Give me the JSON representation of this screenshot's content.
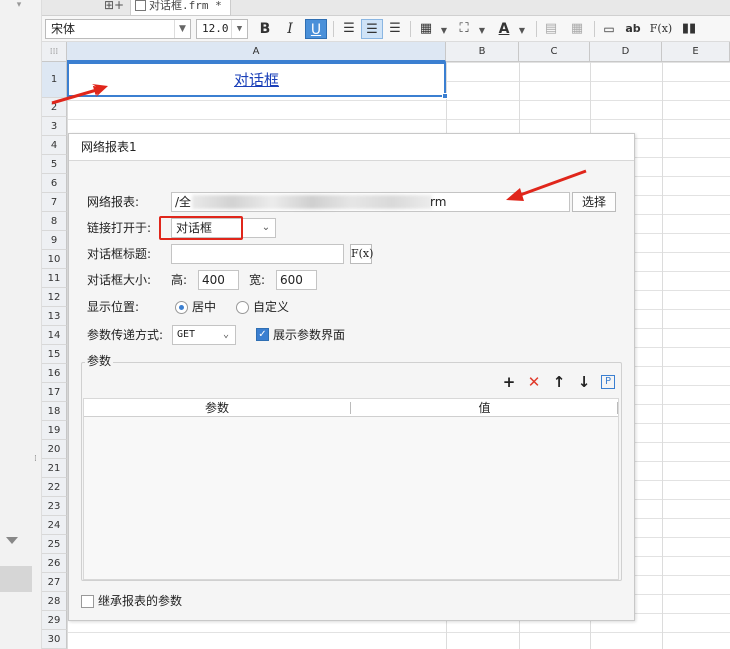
{
  "tab": {
    "label": "对话框.frm *"
  },
  "toolbar": {
    "font_name": "宋体",
    "font_size": "12.0",
    "bold": "B",
    "italic": "I",
    "underline": "U",
    "text_color_glyph": "A",
    "ab_glyph": "ab",
    "fx_glyph": "F(x)"
  },
  "grid": {
    "columns": [
      "A",
      "B",
      "C",
      "D",
      "E"
    ],
    "rows": [
      "1",
      "2",
      "3",
      "4",
      "5",
      "6",
      "7",
      "8",
      "9",
      "10",
      "11",
      "12",
      "13",
      "14",
      "15",
      "16",
      "17",
      "18",
      "19",
      "20",
      "21",
      "22",
      "23",
      "24",
      "25",
      "26",
      "27",
      "28",
      "29",
      "30"
    ],
    "active_cell": "A1",
    "cell_a1_text": "对话框"
  },
  "dialog": {
    "title": "网络报表1",
    "report_label": "网络报表:",
    "report_value_prefix": "/全",
    "report_value_suffix": "rm",
    "choose_button": "选择",
    "open_in_label": "链接打开于:",
    "open_in_value": "对话框",
    "title_label": "对话框标题:",
    "title_value": "",
    "fx_button": "F(x)",
    "size_label": "对话框大小:",
    "height_label": "高:",
    "height_value": "400",
    "width_label": "宽:",
    "width_value": "600",
    "position_label": "显示位置:",
    "position_options": [
      "居中",
      "自定义"
    ],
    "position_selected": "居中",
    "param_method_label": "参数传递方式:",
    "param_method_value": "GET",
    "show_params_label": "展示参数界面",
    "show_params_checked": true,
    "params_section": "参数",
    "params_columns": [
      "参数",
      "值"
    ],
    "params_rows": [],
    "inherit_label": "继承报表的参数",
    "inherit_checked": false
  },
  "colors": {
    "accent": "#3b7fd1",
    "annotation_red": "#e0261b",
    "link_blue": "#1a3fb8"
  }
}
